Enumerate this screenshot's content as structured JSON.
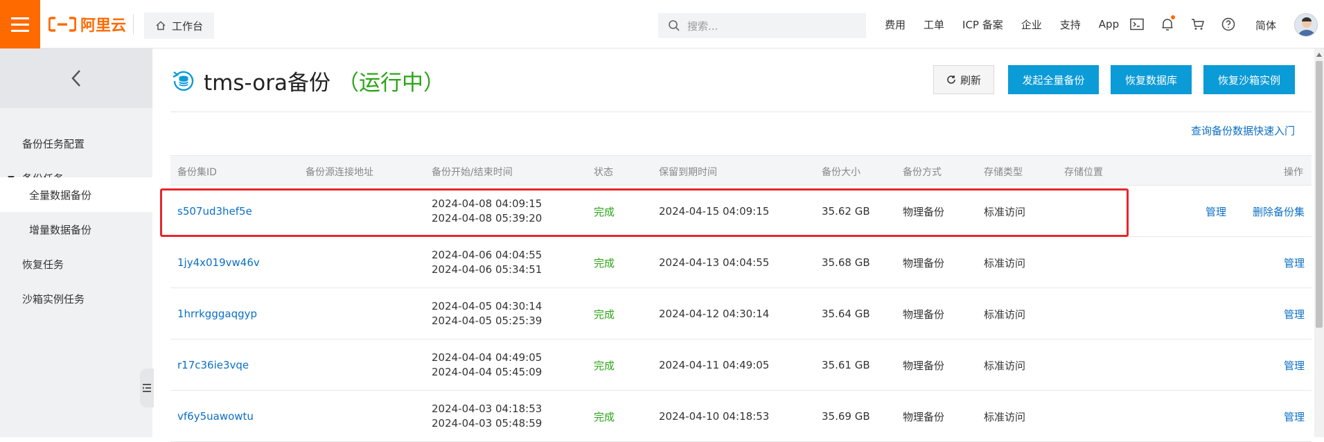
{
  "header": {
    "logo_text": "阿里云",
    "workbench_label": "工作台",
    "search_placeholder": "搜索...",
    "nav": [
      "费用",
      "工单",
      "ICP 备案",
      "企业",
      "支持",
      "App"
    ],
    "language": "简体",
    "icons": [
      "terminal-icon",
      "bell-icon",
      "cart-icon",
      "help-icon"
    ]
  },
  "sidebar": {
    "items": [
      {
        "label": "备份任务配置"
      },
      {
        "label": "备份任务"
      },
      {
        "label": "全量数据备份"
      },
      {
        "label": "增量数据备份"
      },
      {
        "label": "恢复任务"
      },
      {
        "label": "沙箱实例任务"
      }
    ]
  },
  "page": {
    "title": "tms-ora备份",
    "status": "（运行中）",
    "buttons": {
      "refresh": "刷新",
      "full_backup": "发起全量备份",
      "restore_db": "恢复数据库",
      "restore_sandbox": "恢复沙箱实例"
    },
    "quick_link": "查询备份数据快速入门"
  },
  "table": {
    "columns": [
      "备份集ID",
      "备份源连接地址",
      "备份开始/结束时间",
      "状态",
      "保留到期时间",
      "备份大小",
      "备份方式",
      "存储类型",
      "存储位置",
      "操作"
    ],
    "rows": [
      {
        "id": "s507ud3hef5e",
        "source": "",
        "start": "2024-04-08 04:09:15",
        "end": "2024-04-08 05:39:20",
        "status": "完成",
        "expire": "2024-04-15 04:09:15",
        "size": "35.62 GB",
        "method": "物理备份",
        "storage_type": "标准访问",
        "location": "",
        "action_manage": "管理",
        "action_delete": "删除备份集"
      },
      {
        "id": "1jy4x019vw46v",
        "source": "",
        "start": "2024-04-06 04:04:55",
        "end": "2024-04-06 05:34:51",
        "status": "完成",
        "expire": "2024-04-13 04:04:55",
        "size": "35.68 GB",
        "method": "物理备份",
        "storage_type": "标准访问",
        "location": "",
        "action_manage": "管理",
        "action_delete": ""
      },
      {
        "id": "1hrrkgggaqgyp",
        "source": "",
        "start": "2024-04-05 04:30:14",
        "end": "2024-04-05 05:25:39",
        "status": "完成",
        "expire": "2024-04-12 04:30:14",
        "size": "35.64 GB",
        "method": "物理备份",
        "storage_type": "标准访问",
        "location": "",
        "action_manage": "管理",
        "action_delete": ""
      },
      {
        "id": "r17c36ie3vqe",
        "source": "",
        "start": "2024-04-04 04:49:05",
        "end": "2024-04-04 05:45:09",
        "status": "完成",
        "expire": "2024-04-11 04:49:05",
        "size": "35.61 GB",
        "method": "物理备份",
        "storage_type": "标准访问",
        "location": "",
        "action_manage": "管理",
        "action_delete": ""
      },
      {
        "id": "vf6y5uawowtu",
        "source": "",
        "start": "2024-04-03 04:18:53",
        "end": "2024-04-03 05:48:59",
        "status": "完成",
        "expire": "2024-04-10 04:18:53",
        "size": "35.69 GB",
        "method": "物理备份",
        "storage_type": "标准访问",
        "location": "",
        "action_manage": "管理",
        "action_delete": ""
      }
    ]
  },
  "colors": {
    "brand_orange": "#ff6a00",
    "primary_blue": "#0b9bd7",
    "link_blue": "#0b6fc6",
    "success_green": "#2aa515",
    "highlight_red": "#e8252b"
  }
}
